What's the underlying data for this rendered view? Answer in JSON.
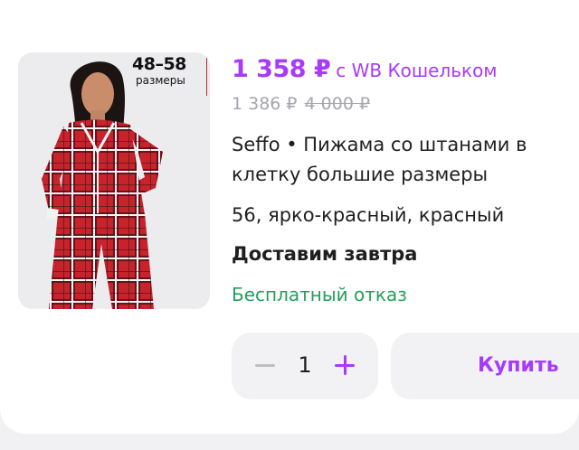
{
  "product": {
    "size_badge": "48–58",
    "size_badge_sub": "размеры",
    "price": "1 358 ₽",
    "wallet_note": "с WB Кошельком",
    "price_old": "1 386 ₽",
    "price_original": "4 000 ₽",
    "title_line1": "Seffo • Пижама со штанами в",
    "title_line2": "клетку большие размеры",
    "variant": "56, ярко-красный, красный",
    "delivery": "Доставим завтра",
    "refusal": "Бесплатный отказ"
  },
  "cart": {
    "quantity": "1",
    "buy_label": "Купить"
  },
  "colors": {
    "accent": "#a73afd",
    "success": "#22a05a",
    "muted": "#a5a5ad",
    "plaid": "#c8222b"
  }
}
